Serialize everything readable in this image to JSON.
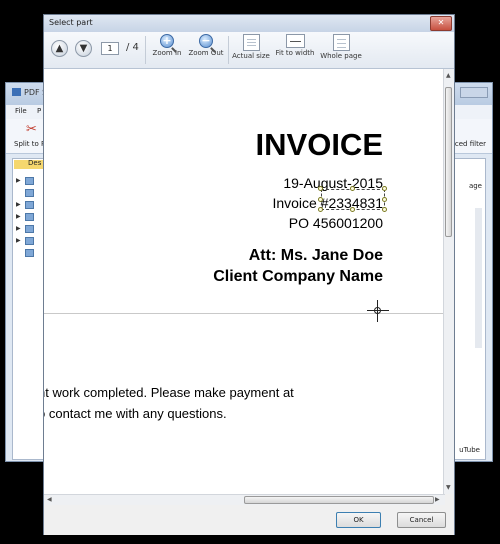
{
  "background_window": {
    "app_title": "PDF S",
    "menu": [
      "File",
      "P"
    ],
    "split_label": "Split to Pl",
    "tree_selected_label": "Des",
    "advanced_filter": "ced filter",
    "page_column": "age",
    "youtube_label": "uTube"
  },
  "dialog": {
    "title": "Select part",
    "close_glyph": "✕",
    "toolbar": {
      "prev_glyph": "▲",
      "next_glyph": "▼",
      "current_page": "1",
      "total_pages": "/ 4",
      "zoom_in": "Zoom In",
      "zoom_out": "Zoom Out",
      "actual_size": "Actual size",
      "fit_to_width": "Fit to width",
      "whole_page": "Whole page"
    },
    "document": {
      "heading": "INVOICE",
      "date": "19-August-2015",
      "invoice_no": "Invoice #2334831",
      "po": "PO 456001200",
      "attention": "Att: Ms. Jane Doe",
      "company": "Client Company Name",
      "body_line_1": "nt work completed. Please make payment at",
      "body_line_2": "o contact me with any questions."
    },
    "buttons": {
      "ok": "OK",
      "cancel": "Cancel"
    }
  }
}
